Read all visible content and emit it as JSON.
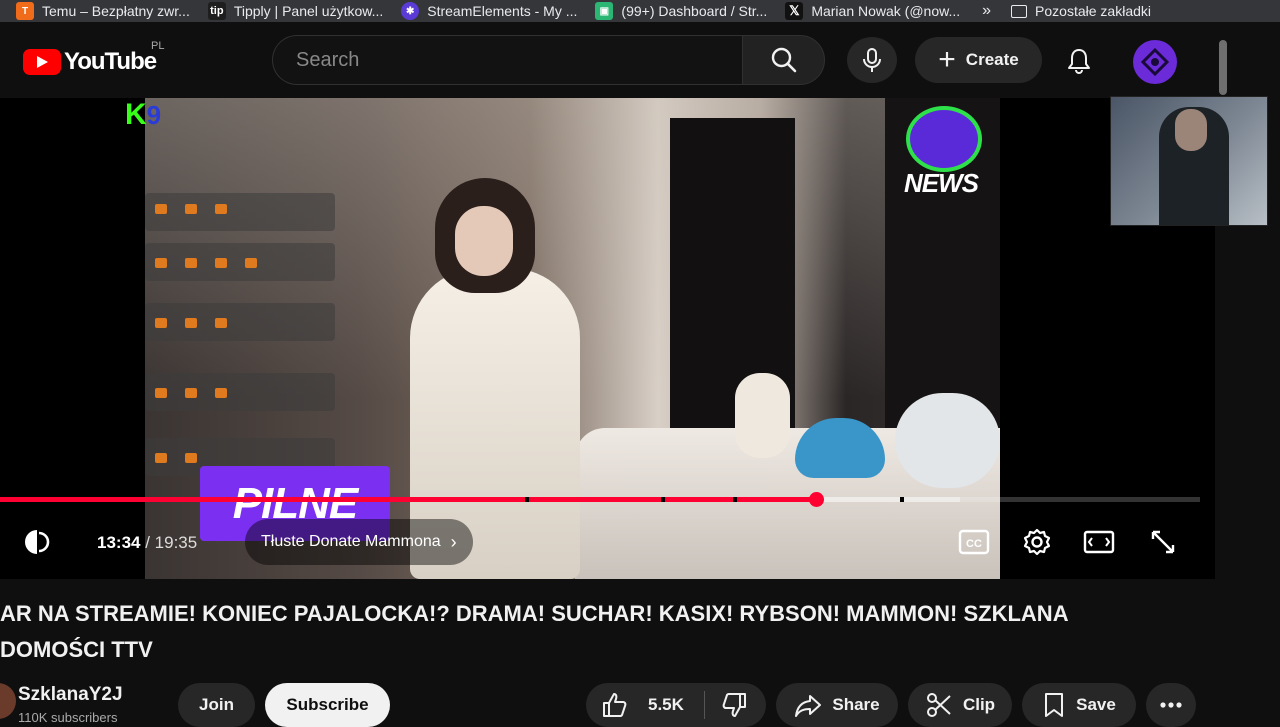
{
  "bookmarks": {
    "items": [
      {
        "label": "Temu – Bezpłatny zwr...",
        "icon": "temu-icon",
        "color": "#f06b1a"
      },
      {
        "label": "Tipply | Panel użytkow...",
        "icon": "tipply-icon",
        "color": "#1e1e1e"
      },
      {
        "label": "StreamElements - My ...",
        "icon": "streamelements-icon",
        "color": "#5a3bd6"
      },
      {
        "label": "(99+) Dashboard / Str...",
        "icon": "twitch-icon",
        "color": "#2bb673"
      },
      {
        "label": "Marian Nowak (@now...",
        "icon": "x-icon",
        "color": "#111111"
      }
    ],
    "more_icon": "double-chevron-icon",
    "other_folder": "Pozostałe zakładki"
  },
  "header": {
    "logo_text": "YouTube",
    "country_code": "PL",
    "search_placeholder": "Search",
    "create_label": "Create",
    "accent": "#ff0000"
  },
  "player": {
    "current_time": "13:34",
    "duration": " / 19:35",
    "chapter_title": "Tłuste Donate Mammona",
    "progress_fraction": 0.68,
    "buffer_fraction": 0.8,
    "overlay_badge": "PILNE",
    "logo_k": "K",
    "logo_9": "9",
    "news_logo_text": "NEWS"
  },
  "video": {
    "title_line1": "AR NA STREAMIE! KONIEC PAJALOCKA!? DRAMA! SUCHAR! KASIX! RYBSON! MAMMON! SZKLANA",
    "title_line2": "DOMOŚCI TTV",
    "channel_name": "SzklanaY2J",
    "subscribers": "110K subscribers",
    "join_label": "Join",
    "subscribe_label": "Subscribe",
    "likes": "5.5K",
    "share_label": "Share",
    "clip_label": "Clip",
    "save_label": "Save"
  }
}
